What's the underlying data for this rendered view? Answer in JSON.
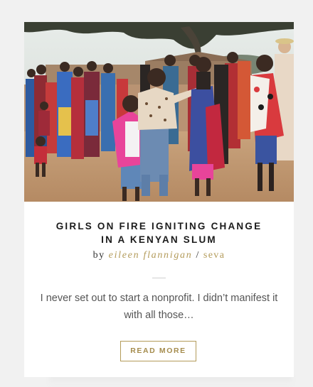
{
  "post": {
    "title_line1": "GIRLS ON FIRE IGNITING CHANGE",
    "title_line2": "IN A KENYAN SLUM",
    "byline_prefix": "by",
    "author": "eileen flannigan",
    "separator": "/",
    "category": "seva",
    "excerpt": "I never set out to start a nonprofit. I didn’t manifest it with all those…",
    "read_more_label": "READ MORE",
    "image_alt": "Group of Kenyan women and girls in colorful clothing dancing and holding hands"
  },
  "colors": {
    "accent": "#b39b5a",
    "title": "#1b1b1b",
    "text": "#555555",
    "background": "#f1f1f1"
  }
}
